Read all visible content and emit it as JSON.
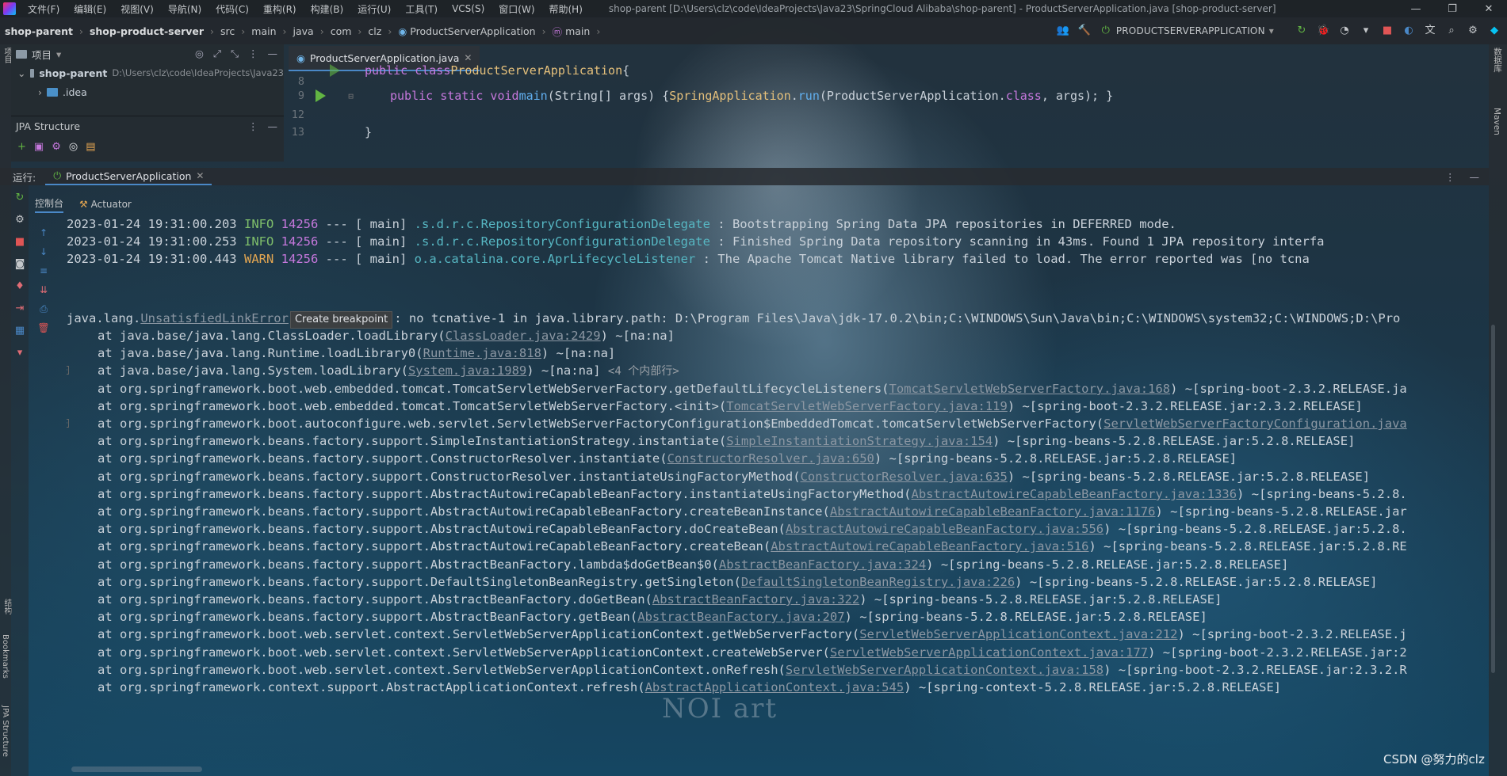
{
  "menubar": {
    "items": [
      "文件(F)",
      "编辑(E)",
      "视图(V)",
      "导航(N)",
      "代码(C)",
      "重构(R)",
      "构建(B)",
      "运行(U)",
      "工具(T)",
      "VCS(S)",
      "窗口(W)",
      "帮助(H)"
    ],
    "window_title": "shop-parent [D:\\Users\\clz\\code\\IdeaProjects\\Java23\\SpringCloud Alibaba\\shop-parent] - ProductServerApplication.java [shop-product-server]",
    "minimize": "—",
    "restore": "❐",
    "close": "✕"
  },
  "navbar": {
    "breadcrumbs": [
      "shop-parent",
      "shop-product-server",
      "src",
      "main",
      "java",
      "com",
      "clz",
      "ProductServerApplication",
      "main"
    ],
    "run_config": "PRODUCTSERVERAPPLICATION"
  },
  "project_panel": {
    "title": "项目",
    "root_name": "shop-parent",
    "root_path": "D:\\Users\\clz\\code\\IdeaProjects\\Java23",
    "child": ".idea"
  },
  "jpa_panel": {
    "title": "JPA Structure"
  },
  "editor": {
    "tab_label": "ProductServerApplication.java",
    "lines": [
      {
        "num": "",
        "text_kw": "public class ",
        "text_cls": "ProductServerApplication",
        "text_rest": " {"
      },
      {
        "num": "8"
      },
      {
        "num": "9",
        "kw": "public static void ",
        "fn": "main",
        "p1": "(String[] args) { ",
        "cls": "SpringApplication",
        "p2": ".",
        "fn2": "run",
        "p3": "(ProductServerApplication.",
        "kw2": "class",
        "p4": ", args); }"
      },
      {
        "num": "12"
      },
      {
        "num": "13",
        "text": "}"
      }
    ]
  },
  "run_window": {
    "label": "运行:",
    "tab": "ProductServerApplication",
    "subtabs": [
      "控制台",
      "Actuator"
    ]
  },
  "console": {
    "log_lines": [
      {
        "ts": "2023-01-24 19:31:00.203",
        "level": "INFO",
        "pid": "14256",
        "thread": "--- [           main]",
        "logger": ".s.d.r.c.RepositoryConfigurationDelegate",
        "msg": " : Bootstrapping Spring Data JPA repositories in DEFERRED mode."
      },
      {
        "ts": "2023-01-24 19:31:00.253",
        "level": "INFO",
        "pid": "14256",
        "thread": "--- [           main]",
        "logger": ".s.d.r.c.RepositoryConfigurationDelegate",
        "msg": " : Finished Spring Data repository scanning in 43ms. Found 1 JPA repository interfa"
      },
      {
        "ts": "2023-01-24 19:31:00.443",
        "level": "WARN",
        "pid": "14256",
        "thread": "--- [           main]",
        "logger": "o.a.catalina.core.AprLifecycleListener",
        "msg": "   : The Apache Tomcat Native library failed to load. The error reported was [no tcna"
      }
    ],
    "exception": {
      "prefix": "java.lang.",
      "link": "UnsatisfiedLinkError",
      "tooltip": "Create breakpoint",
      "rest": ": no tcnative-1 in java.library.path: D:\\Program Files\\Java\\jdk-17.0.2\\bin;C:\\WINDOWS\\Sun\\Java\\bin;C:\\WINDOWS\\system32;C:\\WINDOWS;D:\\Pro"
    },
    "stack": [
      {
        "pre": "at java.base/java.lang.ClassLoader.loadLibrary(",
        "link": "ClassLoader.java:2429",
        "post": ") ~[na:na]"
      },
      {
        "pre": "at java.base/java.lang.Runtime.loadLibrary0(",
        "link": "Runtime.java:818",
        "post": ") ~[na:na]"
      },
      {
        "pre": "at java.base/java.lang.System.loadLibrary(",
        "link": "System.java:1989",
        "post": ") ~[na:na] ",
        "hint": "<4 个内部行>"
      },
      {
        "pre": "at org.springframework.boot.web.embedded.tomcat.TomcatServletWebServerFactory.getDefaultLifecycleListeners(",
        "link": "TomcatServletWebServerFactory.java:168",
        "post": ") ~[spring-boot-2.3.2.RELEASE.ja"
      },
      {
        "pre": "at org.springframework.boot.web.embedded.tomcat.TomcatServletWebServerFactory.<init>(",
        "link": "TomcatServletWebServerFactory.java:119",
        "post": ") ~[spring-boot-2.3.2.RELEASE.jar:2.3.2.RELEASE]"
      },
      {
        "pre": "at org.springframework.boot.autoconfigure.web.servlet.ServletWebServerFactoryConfiguration$EmbeddedTomcat.tomcatServletWebServerFactory(",
        "link": "ServletWebServerFactoryConfiguration.java",
        "post": ""
      },
      {
        "pre": "at org.springframework.beans.factory.support.SimpleInstantiationStrategy.instantiate(",
        "link": "SimpleInstantiationStrategy.java:154",
        "post": ") ~[spring-beans-5.2.8.RELEASE.jar:5.2.8.RELEASE]"
      },
      {
        "pre": "at org.springframework.beans.factory.support.ConstructorResolver.instantiate(",
        "link": "ConstructorResolver.java:650",
        "post": ") ~[spring-beans-5.2.8.RELEASE.jar:5.2.8.RELEASE]"
      },
      {
        "pre": "at org.springframework.beans.factory.support.ConstructorResolver.instantiateUsingFactoryMethod(",
        "link": "ConstructorResolver.java:635",
        "post": ") ~[spring-beans-5.2.8.RELEASE.jar:5.2.8.RELEASE]"
      },
      {
        "pre": "at org.springframework.beans.factory.support.AbstractAutowireCapableBeanFactory.instantiateUsingFactoryMethod(",
        "link": "AbstractAutowireCapableBeanFactory.java:1336",
        "post": ") ~[spring-beans-5.2.8."
      },
      {
        "pre": "at org.springframework.beans.factory.support.AbstractAutowireCapableBeanFactory.createBeanInstance(",
        "link": "AbstractAutowireCapableBeanFactory.java:1176",
        "post": ") ~[spring-beans-5.2.8.RELEASE.jar"
      },
      {
        "pre": "at org.springframework.beans.factory.support.AbstractAutowireCapableBeanFactory.doCreateBean(",
        "link": "AbstractAutowireCapableBeanFactory.java:556",
        "post": ") ~[spring-beans-5.2.8.RELEASE.jar:5.2.8."
      },
      {
        "pre": "at org.springframework.beans.factory.support.AbstractAutowireCapableBeanFactory.createBean(",
        "link": "AbstractAutowireCapableBeanFactory.java:516",
        "post": ") ~[spring-beans-5.2.8.RELEASE.jar:5.2.8.RE"
      },
      {
        "pre": "at org.springframework.beans.factory.support.AbstractBeanFactory.lambda$doGetBean$0(",
        "link": "AbstractBeanFactory.java:324",
        "post": ") ~[spring-beans-5.2.8.RELEASE.jar:5.2.8.RELEASE]"
      },
      {
        "pre": "at org.springframework.beans.factory.support.DefaultSingletonBeanRegistry.getSingleton(",
        "link": "DefaultSingletonBeanRegistry.java:226",
        "post": ") ~[spring-beans-5.2.8.RELEASE.jar:5.2.8.RELEASE]"
      },
      {
        "pre": "at org.springframework.beans.factory.support.AbstractBeanFactory.doGetBean(",
        "link": "AbstractBeanFactory.java:322",
        "post": ") ~[spring-beans-5.2.8.RELEASE.jar:5.2.8.RELEASE]"
      },
      {
        "pre": "at org.springframework.beans.factory.support.AbstractBeanFactory.getBean(",
        "link": "AbstractBeanFactory.java:207",
        "post": ") ~[spring-beans-5.2.8.RELEASE.jar:5.2.8.RELEASE]"
      },
      {
        "pre": "at org.springframework.boot.web.servlet.context.ServletWebServerApplicationContext.getWebServerFactory(",
        "link": "ServletWebServerApplicationContext.java:212",
        "post": ") ~[spring-boot-2.3.2.RELEASE.j"
      },
      {
        "pre": "at org.springframework.boot.web.servlet.context.ServletWebServerApplicationContext.createWebServer(",
        "link": "ServletWebServerApplicationContext.java:177",
        "post": ") ~[spring-boot-2.3.2.RELEASE.jar:2"
      },
      {
        "pre": "at org.springframework.boot.web.servlet.context.ServletWebServerApplicationContext.onRefresh(",
        "link": "ServletWebServerApplicationContext.java:158",
        "post": ") ~[spring-boot-2.3.2.RELEASE.jar:2.3.2.R"
      },
      {
        "pre": "at org.springframework.context.support.AbstractApplicationContext.refresh(",
        "link": "AbstractApplicationContext.java:545",
        "post": ") ~[spring-context-5.2.8.RELEASE.jar:5.2.8.RELEASE]"
      }
    ]
  },
  "side_labels": {
    "left": [
      "项目",
      "结构",
      "Bookmarks",
      "JPA Structure"
    ],
    "right": [
      "数据库",
      "Maven"
    ]
  },
  "watermark": "CSDN @努力的clz",
  "art_text": "NOI art"
}
